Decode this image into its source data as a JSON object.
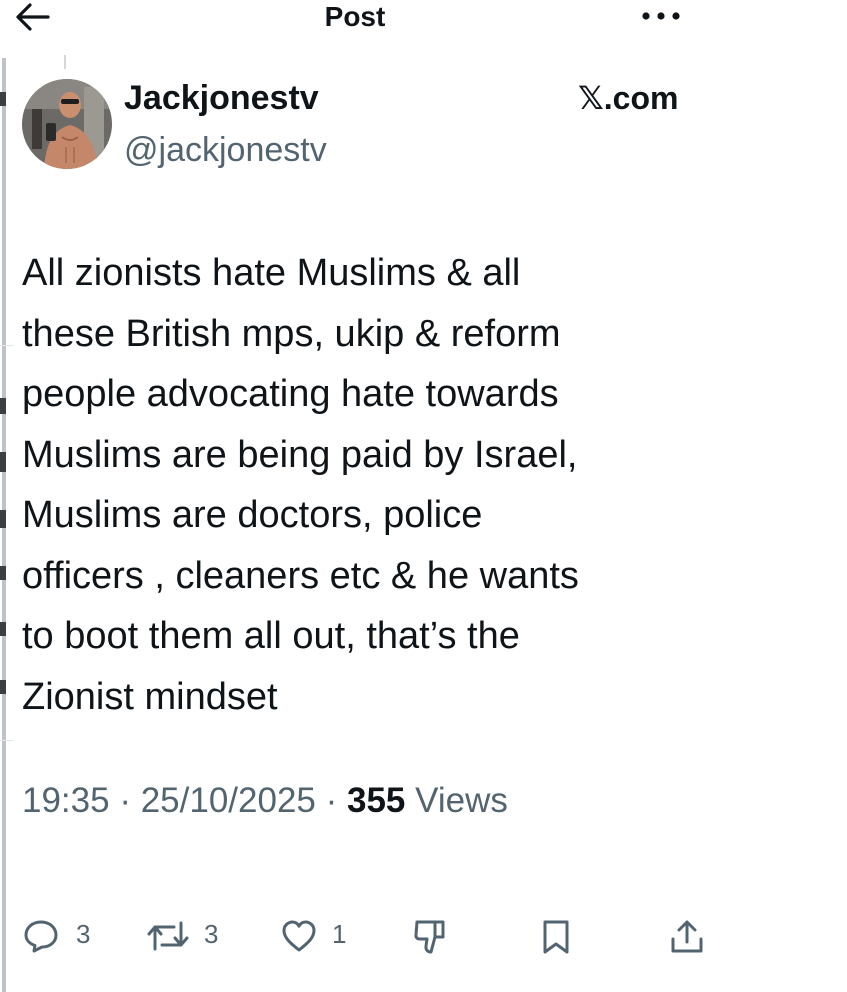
{
  "topbar": {
    "title": "Post",
    "back_icon": "arrow-left-icon",
    "more_icon": "more-horizontal-icon"
  },
  "author": {
    "display_name": "Jackjonestv",
    "handle": "@jackjonestv",
    "avatar_icon": "avatar"
  },
  "watermark": {
    "x_mark": "𝕏",
    "domain": ".com"
  },
  "tweet": {
    "text": "All zionists hate Muslims & all\nthese British mps, ukip & reform\npeople advocating hate towards\nMuslims are being paid by Israel,\nMuslims are doctors, police\nofficers , cleaners etc & he wants\nto boot them all out, that’s the\nZionist mindset"
  },
  "meta": {
    "time": "19:35",
    "separator": " · ",
    "date": "25/10/2025",
    "views_count": "355",
    "views_label": " Views"
  },
  "actions": {
    "reply_count": "3",
    "repost_count": "3",
    "like_count": "1"
  },
  "colors": {
    "text_primary": "#0f1419",
    "text_secondary": "#536471",
    "icon": "#536471"
  }
}
